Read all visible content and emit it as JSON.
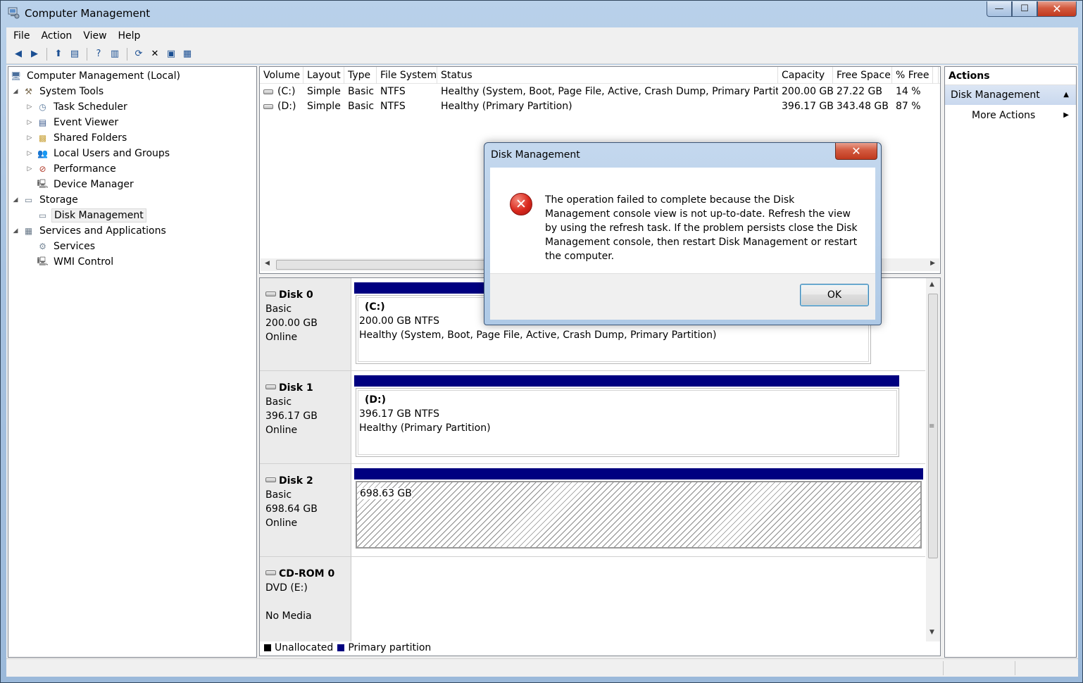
{
  "window": {
    "title": "Computer Management",
    "min": "—",
    "max": "☐",
    "close": "✕"
  },
  "menu": [
    "File",
    "Action",
    "View",
    "Help"
  ],
  "tree": [
    {
      "label": "Computer Management (Local)",
      "exp": "",
      "icon": "computer-icon"
    },
    {
      "label": "System Tools",
      "exp": "◢",
      "icon": "tools-icon"
    },
    {
      "label": "Task Scheduler",
      "exp": "▷",
      "icon": "clock-icon"
    },
    {
      "label": "Event Viewer",
      "exp": "▷",
      "icon": "event-viewer-icon"
    },
    {
      "label": "Shared Folders",
      "exp": "▷",
      "icon": "shared-folder-icon"
    },
    {
      "label": "Local Users and Groups",
      "exp": "▷",
      "icon": "users-icon"
    },
    {
      "label": "Performance",
      "exp": "▷",
      "icon": "performance-icon"
    },
    {
      "label": "Device Manager",
      "exp": "",
      "icon": "device-manager-icon"
    },
    {
      "label": "Storage",
      "exp": "◢",
      "icon": "storage-icon"
    },
    {
      "label": "Disk Management",
      "exp": "",
      "icon": "disk-management-icon"
    },
    {
      "label": "Services and Applications",
      "exp": "◢",
      "icon": "services-apps-icon"
    },
    {
      "label": "Services",
      "exp": "",
      "icon": "services-icon"
    },
    {
      "label": "WMI Control",
      "exp": "",
      "icon": "wmi-icon"
    }
  ],
  "volumes": {
    "columns": [
      "Volume",
      "Layout",
      "Type",
      "File System",
      "Status",
      "Capacity",
      "Free Space",
      "% Free",
      ""
    ],
    "rows": [
      [
        "(C:)",
        "Simple",
        "Basic",
        "NTFS",
        "Healthy (System, Boot, Page File, Active, Crash Dump, Primary Partition)",
        "200.00 GB",
        "27.22 GB",
        "14 %"
      ],
      [
        "(D:)",
        "Simple",
        "Basic",
        "NTFS",
        "Healthy (Primary Partition)",
        "396.17 GB",
        "343.48 GB",
        "87 %"
      ]
    ]
  },
  "disks": [
    {
      "name": "Disk 0",
      "type": "Basic",
      "size": "200.00 GB",
      "state": "Online",
      "partition": {
        "name": "(C:)",
        "size": "200.00 GB NTFS",
        "status": "Healthy (System, Boot, Page File, Active, Crash Dump, Primary Partition)"
      }
    },
    {
      "name": "Disk 1",
      "type": "Basic",
      "size": "396.17 GB",
      "state": "Online",
      "partition": {
        "name": "(D:)",
        "size": "396.17 GB NTFS",
        "status": "Healthy (Primary Partition)"
      }
    },
    {
      "name": "Disk 2",
      "type": "Basic",
      "size": "698.64 GB",
      "state": "Online",
      "unallocated": "698.63 GB"
    },
    {
      "name": "CD-ROM 0",
      "type": "DVD (E:)",
      "size": "",
      "state": "No Media"
    }
  ],
  "legend": {
    "unallocated": "Unallocated",
    "primary": "Primary partition",
    "unallocated_color": "#000000",
    "primary_color": "#000080"
  },
  "actions": {
    "header": "Actions",
    "group": "Disk Management",
    "more": "More Actions"
  },
  "dialog": {
    "title": "Disk Management",
    "message": "The operation failed to complete because the Disk Management console view is not up-to-date.  Refresh the view by using the refresh task. If the problem persists close the Disk Management console, then restart Disk Management or restart the computer.",
    "ok": "OK",
    "close": "✕",
    "icon": "✕"
  }
}
